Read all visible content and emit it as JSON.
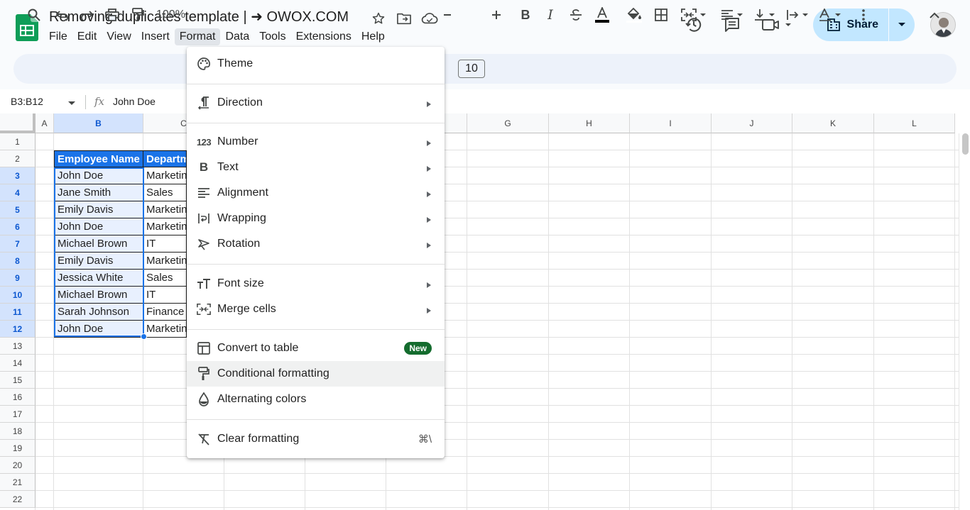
{
  "header": {
    "title": "Removing duplicates template | ➜ OWOX.COM",
    "menus": [
      "File",
      "Edit",
      "View",
      "Insert",
      "Format",
      "Data",
      "Tools",
      "Extensions",
      "Help"
    ],
    "active_menu": "Format",
    "share_label": "Share"
  },
  "toolbar": {
    "zoom": "100%",
    "font_size": "10"
  },
  "formula_bar": {
    "name_box": "B3:B12",
    "fx": "fx",
    "value": "John Doe"
  },
  "grid": {
    "columns": [
      "A",
      "B",
      "C",
      "G",
      "H",
      "I",
      "J",
      "K",
      "L"
    ],
    "rows": [
      "1",
      "2",
      "3",
      "4",
      "5",
      "6",
      "7",
      "8",
      "9",
      "10",
      "11",
      "12",
      "13",
      "14",
      "15",
      "16",
      "17",
      "18",
      "19",
      "20",
      "21",
      "22"
    ],
    "header_cells": [
      "Employee Name",
      "Departm"
    ],
    "data": [
      [
        "John Doe",
        "Marketin"
      ],
      [
        "Jane Smith",
        "Sales"
      ],
      [
        "Emily Davis",
        "Marketin"
      ],
      [
        "John Doe",
        "Marketin"
      ],
      [
        "Michael Brown",
        "IT"
      ],
      [
        "Emily Davis",
        "Marketin"
      ],
      [
        "Jessica White",
        "Sales"
      ],
      [
        "Michael Brown",
        "IT"
      ],
      [
        "Sarah Johnson",
        "Finance"
      ],
      [
        "John Doe",
        "Marketin"
      ]
    ]
  },
  "format_menu": {
    "items": [
      {
        "label": "Theme",
        "icon": "palette-icon"
      },
      {
        "label": "Direction",
        "icon": "paragraph-direction-icon"
      },
      {
        "label": "Number",
        "icon": "number-123-icon"
      },
      {
        "label": "Text",
        "icon": "bold-b-icon"
      },
      {
        "label": "Alignment",
        "icon": "align-left-icon"
      },
      {
        "label": "Wrapping",
        "icon": "wrap-icon"
      },
      {
        "label": "Rotation",
        "icon": "text-rotation-icon"
      },
      {
        "label": "Font size",
        "icon": "font-size-icon"
      },
      {
        "label": "Merge cells",
        "icon": "merge-icon"
      },
      {
        "label": "Convert to table",
        "icon": "table-icon",
        "badge": "New"
      },
      {
        "label": "Conditional formatting",
        "icon": "paint-roller-icon"
      },
      {
        "label": "Alternating colors",
        "icon": "droplet-icon"
      },
      {
        "label": "Clear formatting",
        "icon": "clear-format-icon",
        "shortcut": "⌘\\"
      }
    ]
  },
  "colors": {
    "accent": "#1a73e8",
    "share_bg": "#c2e7ff",
    "new_badge": "#146c2e",
    "sheets_green": "#0f9d58"
  }
}
